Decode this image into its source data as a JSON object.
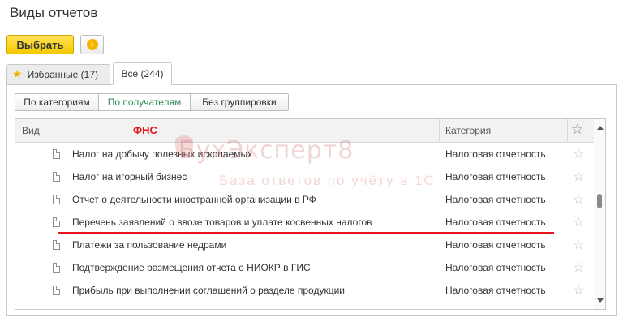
{
  "window": {
    "title": "Виды отчетов"
  },
  "toolbar": {
    "select_label": "Выбрать",
    "info_icon": "i"
  },
  "tabs": [
    {
      "label": "Избранные (17)",
      "icon": "star-icon",
      "active": false
    },
    {
      "label": "Все (244)",
      "active": true
    }
  ],
  "grouping": [
    "По категориям",
    "По получателям",
    "Без группировки"
  ],
  "grid": {
    "header": {
      "name": "Вид",
      "group": "ФНС",
      "category": "Категория",
      "star": "☆"
    },
    "rows": [
      {
        "name": "Налог на добычу полезных ископаемых",
        "category": "Налоговая отчетность"
      },
      {
        "name": "Налог на игорный бизнес",
        "category": "Налоговая отчетность"
      },
      {
        "name": "Отчет о деятельности иностранной организации в РФ",
        "category": "Налоговая отчетность"
      },
      {
        "name": "Перечень заявлений о ввозе товаров и уплате косвенных налогов",
        "category": "Налоговая отчетность"
      },
      {
        "name": "Платежи за пользование недрами",
        "category": "Налоговая отчетность"
      },
      {
        "name": "Подтверждение размещения отчета о НИОКР в ГИС",
        "category": "Налоговая отчетность"
      },
      {
        "name": "Прибыль при выполнении соглашений о разделе продукции",
        "category": "Налоговая отчетность"
      }
    ],
    "row_star": "☆"
  },
  "watermark": {
    "line1": "БухЭксперт8",
    "line2": "База ответов по учёту в 1С"
  },
  "colors": {
    "accent_yellow": "#f5c800",
    "fns_red": "#e8121a",
    "active_green": "#2e8b57"
  }
}
